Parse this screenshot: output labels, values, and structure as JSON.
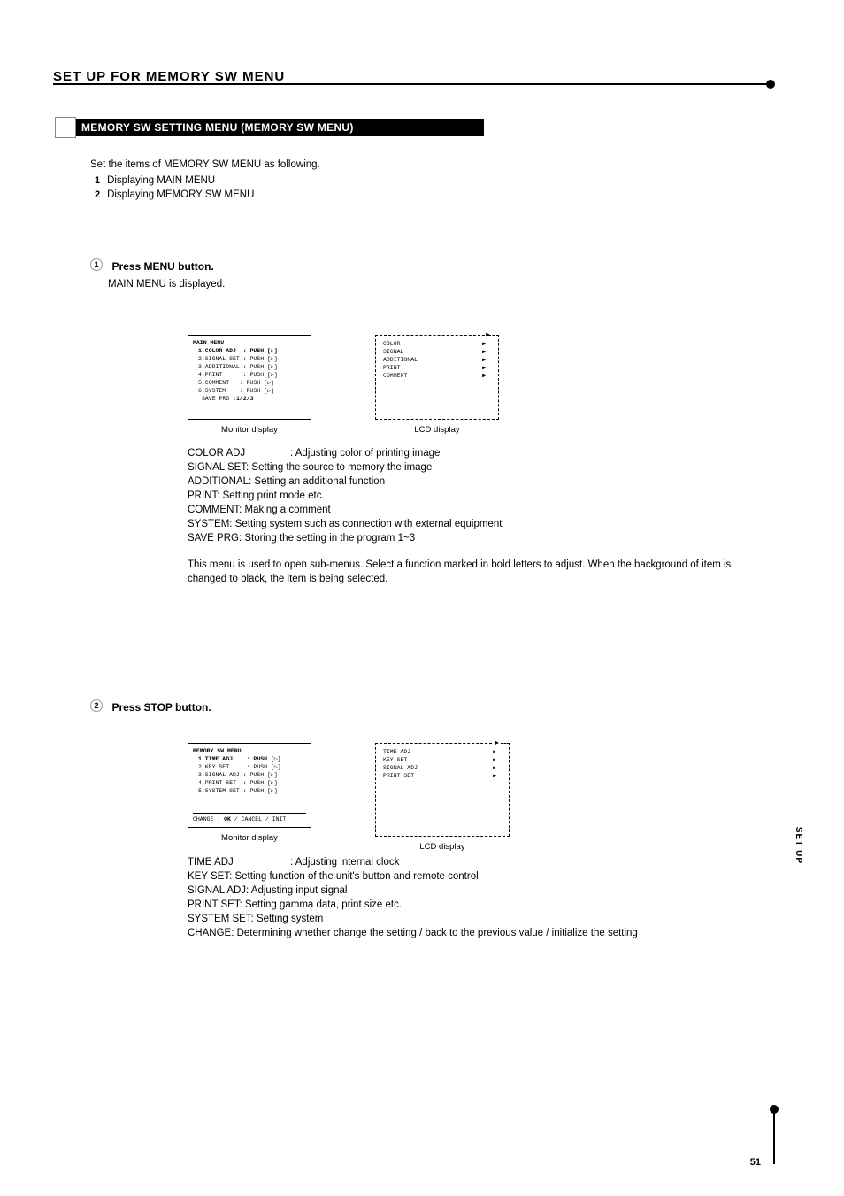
{
  "header": {
    "titleTop": "SET UP FOR MEMORY SW MENU"
  },
  "sectionBar": "MEMORY SW SETTING MENU (MEMORY SW MENU)",
  "intro": "Set the items of MEMORY SW MENU as following.",
  "step1": {
    "numGlyph": "1",
    "label": "Displaying MAIN MENU",
    "text": "Displaying MEMORY SW MENU"
  },
  "step2": {
    "numGlyph": "2"
  },
  "blockA": {
    "num": "1",
    "heading": "Press MENU button.",
    "body": "MAIN MENU is displayed."
  },
  "mainMenu": {
    "title": "MAIN MENU",
    "items": [
      {
        "label": "1.COLOR ADJ",
        "action": ": PUSH [▷]",
        "bold": true
      },
      {
        "label": "2.SIGNAL SET",
        "action": ": PUSH [▷]"
      },
      {
        "label": "3.ADDITIONAL",
        "action": ": PUSH [▷]"
      },
      {
        "label": "4.PRINT",
        "action": ": PUSH [▷]"
      },
      {
        "label": "5.COMMENT",
        "action": ": PUSH [▷]"
      },
      {
        "label": "6.SYSTEM",
        "action": ": PUSH [▷]"
      }
    ],
    "save": "SAVE PRG :",
    "saveRight": "1/2/3"
  },
  "lcdMain": {
    "items": [
      "COLOR",
      "SIGNAL",
      "ADDITIONAL",
      "PRINT",
      "COMMENT"
    ]
  },
  "monitorLabel": "Monitor display",
  "lcdLabel": "LCD display",
  "menuDesc": [
    {
      "lbl": "COLOR ADJ",
      "txt": ": Adjusting color of printing image"
    },
    {
      "lbl": "SIGNAL SET",
      "txt": ": Setting the source to memory the image"
    },
    {
      "lbl": "ADDITIONAL",
      "txt": ": Setting an additional function"
    },
    {
      "lbl": "PRINT",
      "txt": ": Setting print mode etc."
    },
    {
      "lbl": "COMMENT",
      "txt": ": Making a comment"
    },
    {
      "lbl": "SYSTEM",
      "txt": ": Setting system such as connection with external equipment"
    },
    {
      "lbl": "SAVE PRG",
      "txt": ": Storing the setting in the program  1~3"
    }
  ],
  "mainMenuNote": "This menu is used to open sub-menus. Select a function marked in bold letters to adjust. When the background of item is changed to black, the item is being selected.",
  "blockB": {
    "num": "2",
    "heading": "Press STOP button."
  },
  "memoryMenu": {
    "title": "MEMORY SW MENU",
    "items": [
      {
        "label": "1.TIME ADJ",
        "action": ": PUSH [▷]",
        "bold": true
      },
      {
        "label": "2.KEY SET",
        "action": ": PUSH [▷]"
      },
      {
        "label": "3.SIGNAL ADJ",
        "action": ": PUSH [▷]"
      },
      {
        "label": "4.PRINT SET",
        "action": ": PUSH [▷]"
      },
      {
        "label": "5.SYSTEM SET",
        "action": ": PUSH [▷]"
      }
    ],
    "change": "CHANGE : OK / CANCEL / INIT",
    "changeBold": "OK"
  },
  "lcdMemory": {
    "items": [
      "TIME ADJ",
      "KEY SET",
      "SIGNAL ADJ",
      "PRINT SET",
      ""
    ]
  },
  "menuDesc2": [
    {
      "lbl": "TIME ADJ",
      "txt": ": Adjusting internal clock"
    },
    {
      "lbl": "KEY SET",
      "txt": ": Setting function of the unit's button and remote control"
    },
    {
      "lbl": "SIGNAL ADJ",
      "txt": ": Adjusting input signal"
    },
    {
      "lbl": "PRINT SET",
      "txt": ": Setting gamma data, print size etc."
    },
    {
      "lbl": "SYSTEM SET",
      "txt": ": Setting system"
    },
    {
      "lbl": "CHANGE",
      "txt": ": Determining whether change the setting / back to the previous value / initialize the setting"
    }
  ],
  "page": "51",
  "sideLabel": "SET UP"
}
